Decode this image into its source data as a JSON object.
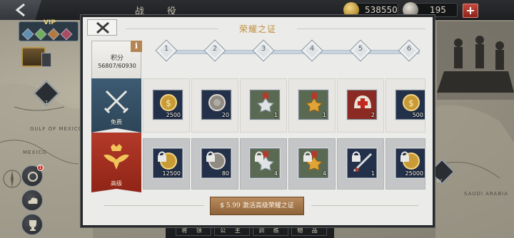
{
  "topbar": {
    "title": "战 役",
    "gold": "538550",
    "silver": "195",
    "plus_label": "+"
  },
  "vip": {
    "label": "VIP"
  },
  "side": {
    "unit_badge": "1",
    "mail_badge": "1",
    "unit_badge_right": "IV"
  },
  "map": {
    "label_gulf": "GULF OF MEXICO",
    "label_mexico": "MEXICO",
    "label_saudi": "SAUDI ARABIA"
  },
  "bottom_tabs": [
    "将 领",
    "公 主",
    "训 练",
    "物 品"
  ],
  "modal": {
    "title": "荣耀之证",
    "close_icon": "close-x",
    "points_label": "积分",
    "points_value": "56807/60930",
    "info_label": "i",
    "levels": [
      "1",
      "2",
      "3",
      "4",
      "5",
      "6"
    ],
    "free_label": "免费",
    "premium_label": "高级",
    "activate_label": "$ 5.99 激活高级荣耀之证",
    "free_rewards": [
      {
        "icon": "gold-coin-icon",
        "qty": "2500"
      },
      {
        "icon": "silver-coin-icon",
        "qty": "20"
      },
      {
        "icon": "silver-medal-icon",
        "qty": "1"
      },
      {
        "icon": "gold-medal-icon",
        "qty": "1"
      },
      {
        "icon": "red-cross-helmet-icon",
        "qty": "2"
      },
      {
        "icon": "gold-coin-icon",
        "qty": "500"
      }
    ],
    "premium_rewards": [
      {
        "icon": "gold-coin-icon",
        "qty": "12500"
      },
      {
        "icon": "silver-coin-icon",
        "qty": "80"
      },
      {
        "icon": "silver-medal-icon",
        "qty": "4"
      },
      {
        "icon": "gold-medal-icon",
        "qty": "4"
      },
      {
        "icon": "crossed-swords-icon",
        "qty": "1"
      },
      {
        "icon": "gold-coin-icon",
        "qty": "25000"
      }
    ]
  },
  "colors": {
    "title_gold": "#c08e3e",
    "free_ribbon": "#3d5b73",
    "premium_ribbon": "#b33a2a",
    "activate_button": "#a77a4d"
  }
}
